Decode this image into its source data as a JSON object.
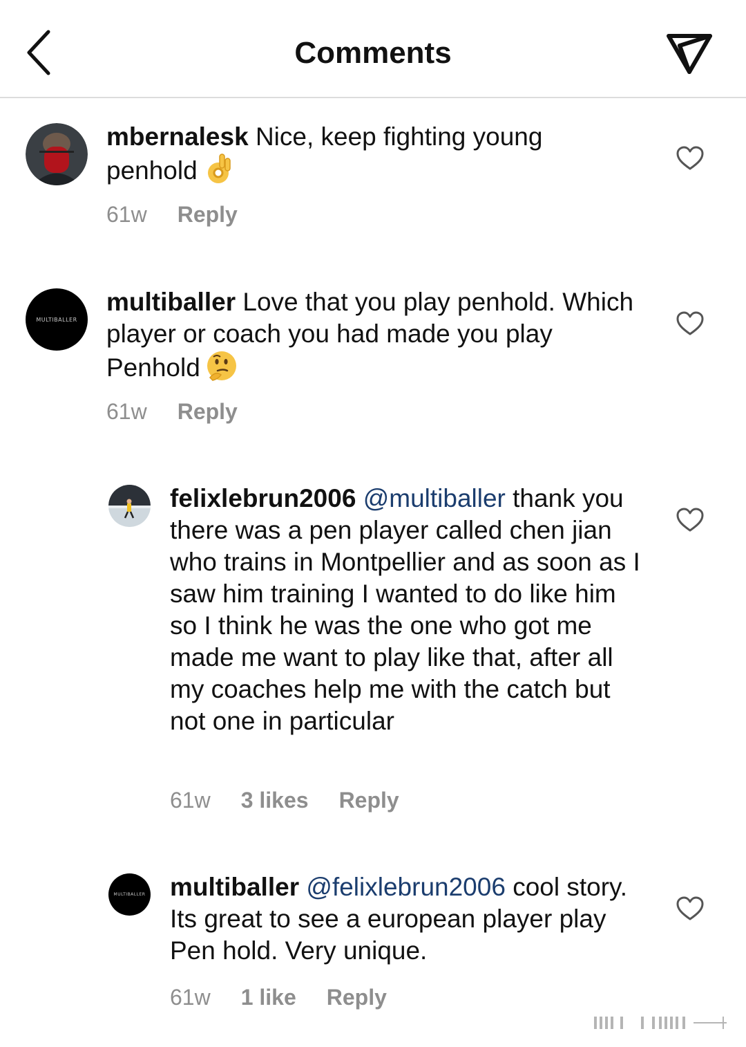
{
  "header": {
    "title": "Comments",
    "back_icon": "chevron-left-icon",
    "share_icon": "send-icon"
  },
  "comments": [
    {
      "username": "mbernalesk",
      "mention": "",
      "text": " Nice, keep fighting young penhold",
      "emoji": "ok-hand-emoji",
      "time": "61w",
      "likes": "",
      "reply_label": "Reply"
    },
    {
      "username": "multiballer",
      "avatar_text": "MULTIBALLER",
      "mention": "",
      "text": " Love that you play penhold. Which player or coach you had made you play Penhold",
      "emoji": "thinking-face-emoji",
      "time": "61w",
      "likes": "",
      "reply_label": "Reply"
    },
    {
      "username": "felixlebrun2006",
      "mention": "@multiballer",
      "text": " thank you there was a pen player called chen jian who trains in Montpellier and as soon as I saw him training I wanted to do like him so I think he was the one who got me made me want to play like that, after all my coaches help me with the catch but not one in particular",
      "time": "61w",
      "likes": "3 likes",
      "reply_label": "Reply"
    },
    {
      "username": "multiballer",
      "avatar_text": "MULTIBALLER",
      "mention": "@felixlebrun2006",
      "text": " cool story. Its great to see a european player play Pen hold. Very unique.",
      "time": "61w",
      "likes": "1 like",
      "reply_label": "Reply"
    }
  ],
  "colors": {
    "text": "#111111",
    "meta": "#8e8e8e",
    "mention": "#1b3d6e",
    "divider": "#dcdcdc"
  }
}
